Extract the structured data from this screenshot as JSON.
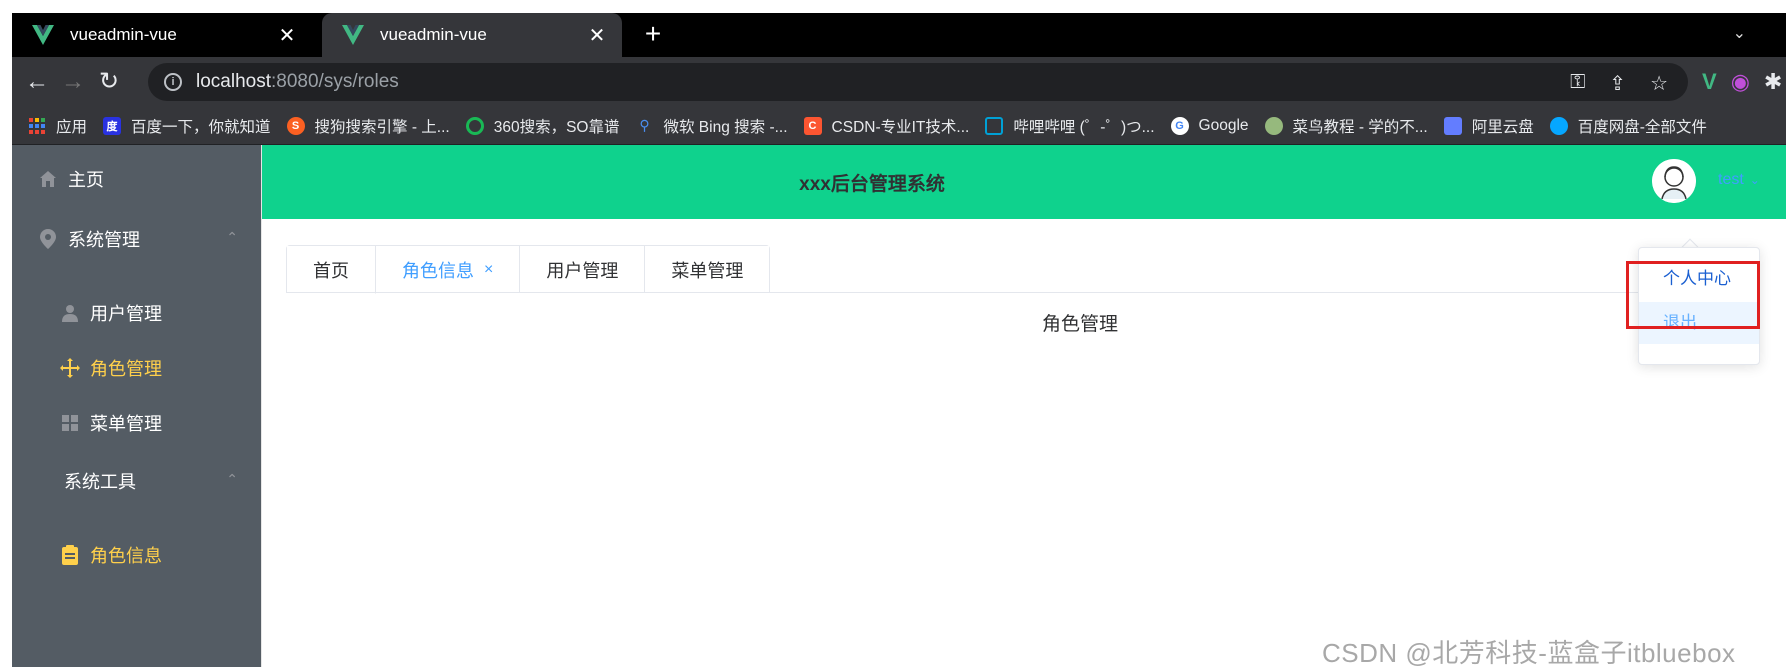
{
  "browser": {
    "tabs": [
      {
        "title": "vueadmin-vue",
        "close": "✕"
      },
      {
        "title": "vueadmin-vue",
        "close": "✕"
      }
    ],
    "new_tab": "+",
    "tab_search": "⌄",
    "url_host": "localhost",
    "url_path": ":8080/sys/roles",
    "bookmarks": [
      {
        "label": "应用",
        "icon_color": "#ea4335"
      },
      {
        "label": "百度一下，你就知道",
        "icon_color": "#2932e1"
      },
      {
        "label": "搜狗搜索引擎 - 上...",
        "icon_color": "#fb6022"
      },
      {
        "label": "360搜索，SO靠谱",
        "icon_color": "#19b955"
      },
      {
        "label": "微软 Bing 搜索 -...",
        "icon_color": "#174ae4"
      },
      {
        "label": "CSDN-专业IT技术...",
        "icon_color": "#fc5531"
      },
      {
        "label": "哔哩哔哩 (゜-゜)つ...",
        "icon_color": "#00a1d6"
      },
      {
        "label": "Google",
        "icon_color": "#4285f4"
      },
      {
        "label": "菜鸟教程 - 学的不...",
        "icon_color": "#96b97d"
      },
      {
        "label": "阿里云盘",
        "icon_color": "#637dff"
      },
      {
        "label": "百度网盘-全部文件",
        "icon_color": "#06a7ff"
      }
    ]
  },
  "sidebar": {
    "items": [
      {
        "label": "主页",
        "icon": "home-icon"
      },
      {
        "label": "系统管理",
        "icon": "location-icon",
        "caret": "⌃"
      },
      {
        "label": "用户管理",
        "icon": "user-icon"
      },
      {
        "label": "角色管理",
        "icon": "rank-icon",
        "active": true
      },
      {
        "label": "菜单管理",
        "icon": "menu-icon"
      },
      {
        "label": "系统工具",
        "caret": "⌃"
      },
      {
        "label": "角色信息",
        "icon": "document-icon",
        "active": true
      }
    ]
  },
  "header": {
    "title": "xxx后台管理系统",
    "username": "test",
    "username_caret": "⌄"
  },
  "tabs": [
    {
      "label": "首页"
    },
    {
      "label": "角色信息",
      "active": true,
      "close": "×"
    },
    {
      "label": "用户管理"
    },
    {
      "label": "菜单管理"
    }
  ],
  "main": {
    "content": "角色管理"
  },
  "dropdown": {
    "items": [
      "个人中心",
      "退出"
    ]
  },
  "watermark": "CSDN @北芳科技-蓝盒子itbluebox",
  "colors": {
    "header_bg": "#0fd28d",
    "sidebar_bg": "#545c64",
    "active_menu": "#ffd04b",
    "link_blue": "#409eff",
    "highlight_box": "#e02020"
  }
}
